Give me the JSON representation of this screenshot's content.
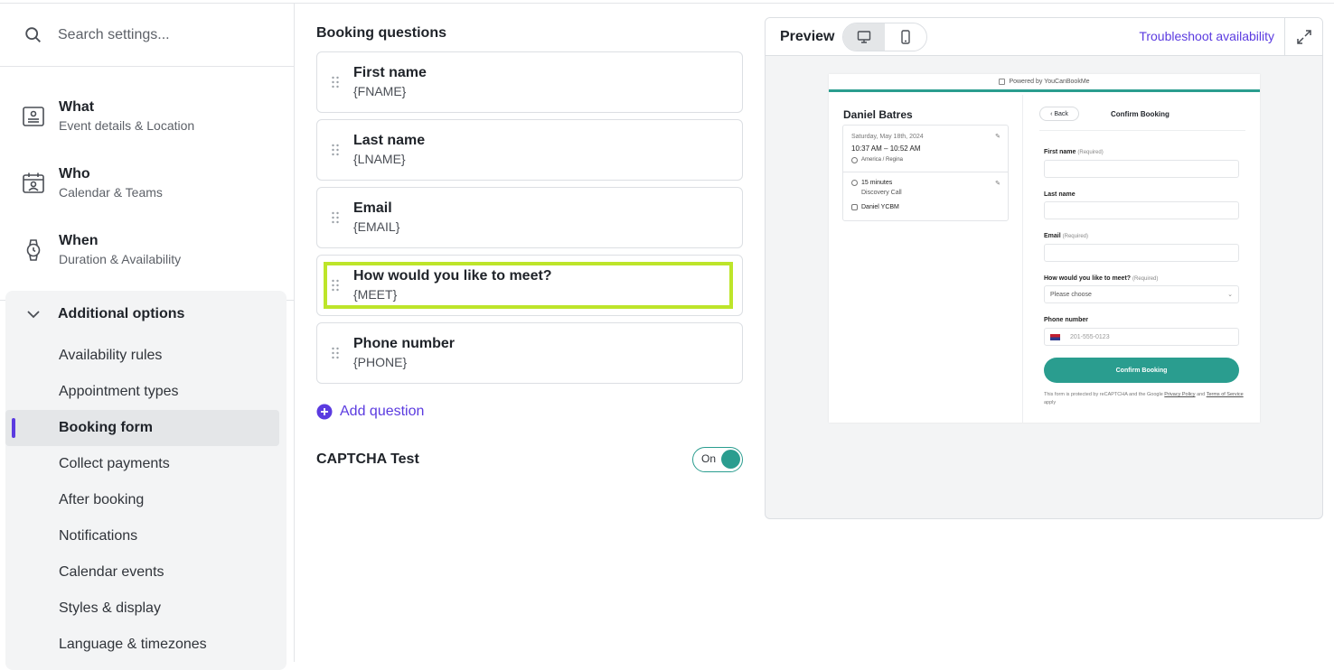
{
  "search": {
    "placeholder": "Search settings..."
  },
  "nav": [
    {
      "title": "What",
      "sub": "Event details & Location",
      "icon": "event-details-icon"
    },
    {
      "title": "Who",
      "sub": "Calendar & Teams",
      "icon": "calendar-person-icon"
    },
    {
      "title": "When",
      "sub": "Duration & Availability",
      "icon": "watch-icon"
    }
  ],
  "options": {
    "header": "Additional options",
    "items": [
      "Availability rules",
      "Appointment types",
      "Booking form",
      "Collect payments",
      "After booking",
      "Notifications",
      "Calendar events",
      "Styles & display",
      "Language & timezones"
    ],
    "active_index": 2
  },
  "booking": {
    "title": "Booking questions",
    "questions": [
      {
        "title": "First name",
        "code": "{FNAME}"
      },
      {
        "title": "Last name",
        "code": "{LNAME}"
      },
      {
        "title": "Email",
        "code": "{EMAIL}"
      },
      {
        "title": "How would you like to meet?",
        "code": "{MEET}",
        "highlighted": true
      },
      {
        "title": "Phone number",
        "code": "{PHONE}"
      }
    ],
    "add_label": "Add question",
    "captcha_label": "CAPTCHA Test",
    "captcha_state": "On"
  },
  "preview": {
    "label": "Preview",
    "troubleshoot": "Troubleshoot availability",
    "powered": "Powered by YouCanBookMe",
    "host": "Daniel Batres",
    "date": "Saturday, May 18th, 2024",
    "time": "10:37 AM – 10:52 AM",
    "timezone": "America / Regina",
    "duration": "15 minutes",
    "event_type": "Discovery Call",
    "attendee": "Daniel YCBM",
    "back": "Back",
    "confirm_title": "Confirm Booking",
    "fields": {
      "first_name": "First name",
      "last_name": "Last name",
      "email": "Email",
      "meet": "How would you like to meet?",
      "phone": "Phone number",
      "required": "(Required)",
      "meet_placeholder": "Please choose",
      "phone_placeholder": "201-555-0123"
    },
    "confirm_button": "Confirm Booking",
    "disclaimer_a": "This form is protected by reCAPTCHA and the Google",
    "privacy": "Privacy Policy",
    "and": "and",
    "terms": "Terms of Service",
    "apply": "apply"
  },
  "colors": {
    "accent": "#5b3be0",
    "teal": "#2a9d8f",
    "highlight": "#bde52a"
  }
}
